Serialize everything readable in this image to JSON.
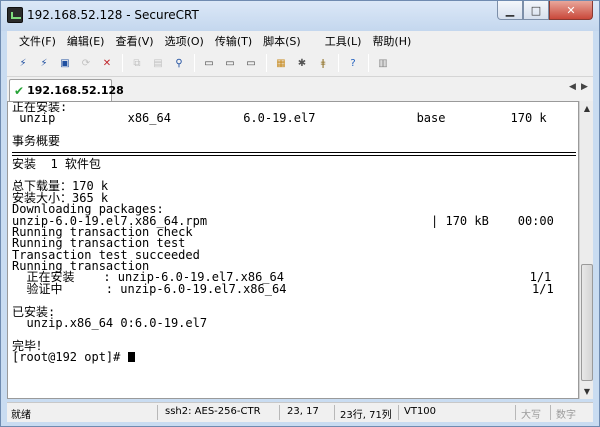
{
  "window": {
    "title": "192.168.52.128 - SecureCRT",
    "minimize_glyph": "▁",
    "maximize_glyph": "□",
    "close_glyph": "✕"
  },
  "menu": {
    "items": [
      {
        "label": "文件(F)"
      },
      {
        "label": "编辑(E)"
      },
      {
        "label": "查看(V)"
      },
      {
        "label": "选项(O)"
      },
      {
        "label": "传输(T)"
      },
      {
        "label": "脚本(S)"
      },
      {
        "label": "工具(L)"
      },
      {
        "label": "帮助(H)"
      }
    ]
  },
  "toolbar": {
    "icons": [
      {
        "name": "connect-icon",
        "glyph": "⚡",
        "color": "#1f4fa0",
        "enabled": true
      },
      {
        "name": "quick-connect-icon",
        "glyph": "⚡",
        "color": "#1f4fa0",
        "enabled": true
      },
      {
        "name": "connect-tab-icon",
        "glyph": "▣",
        "color": "#1f4fa0",
        "enabled": true
      },
      {
        "name": "reconnect-icon",
        "glyph": "⟳",
        "color": "#888888",
        "enabled": false
      },
      {
        "name": "disconnect-icon",
        "glyph": "✕",
        "color": "#c0272d",
        "enabled": true
      },
      {
        "name": "copy-icon",
        "glyph": "⧉",
        "color": "#888888",
        "enabled": false
      },
      {
        "name": "paste-icon",
        "glyph": "▤",
        "color": "#888888",
        "enabled": false
      },
      {
        "name": "find-icon",
        "glyph": "⚲",
        "color": "#1f4fa0",
        "enabled": true
      },
      {
        "name": "print-setup-icon",
        "glyph": "▭",
        "color": "#444444",
        "enabled": true
      },
      {
        "name": "print-selection-icon",
        "glyph": "▭",
        "color": "#444444",
        "enabled": true
      },
      {
        "name": "print-icon",
        "glyph": "▭",
        "color": "#444444",
        "enabled": true
      },
      {
        "name": "session-options-icon",
        "glyph": "▦",
        "color": "#c78a1e",
        "enabled": true
      },
      {
        "name": "global-options-icon",
        "glyph": "✱",
        "color": "#555555",
        "enabled": true
      },
      {
        "name": "keymap-icon",
        "glyph": "ǂ",
        "color": "#8a6a1a",
        "enabled": true
      },
      {
        "name": "help-icon",
        "glyph": "?",
        "color": "#1f5fbf",
        "enabled": true
      },
      {
        "name": "sftp-icon",
        "glyph": "▥",
        "color": "#888888",
        "enabled": true
      }
    ]
  },
  "tabs": [
    {
      "label": "192.168.52.128",
      "active": true
    }
  ],
  "tab_nav": {
    "prev": "◀",
    "next": "▶"
  },
  "terminal": {
    "lines": [
      "正在安装:",
      " unzip          x86_64          6.0-19.el7              base         170 k",
      "",
      "事务概要",
      "==RULE==",
      "安装  1 软件包",
      "",
      "总下载量：170 k",
      "安装大小：365 k",
      "Downloading packages:",
      "unzip-6.0-19.el7.x86_64.rpm                               | 170 kB    00:00",
      "Running transaction check",
      "Running transaction test",
      "Transaction test succeeded",
      "Running transaction",
      "  正在安装    : unzip-6.0-19.el7.x86_64                                  1/1",
      "  验证中      : unzip-6.0-19.el7.x86_64                                  1/1",
      "",
      "已安装:",
      "  unzip.x86_64 0:6.0-19.el7",
      "",
      "完毕！",
      "[root@192 opt]# "
    ]
  },
  "scrollbar": {
    "up": "▲",
    "down": "▼"
  },
  "status": {
    "ready": "就绪",
    "protocol": "ssh2: AES-256-CTR",
    "position": "23, 17",
    "size": "23行, 71列",
    "terminal_type": "VT100",
    "caps": "大写",
    "num": "数字"
  }
}
